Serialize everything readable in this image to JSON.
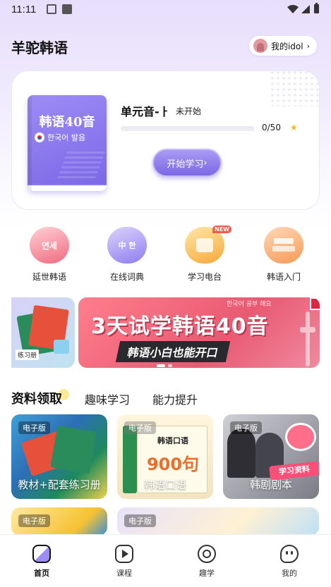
{
  "status": {
    "time": "11:11"
  },
  "header": {
    "title": "羊驼韩语",
    "idol_label": "我的idol"
  },
  "study_card": {
    "book_title": "韩语40音",
    "book_subtitle": "한국어 발음",
    "unit_title": "单元音-ㅏ",
    "unit_status": "未开始",
    "progress_text": "0/50",
    "progress_fraction": 0,
    "start_button": "开始学习"
  },
  "quick_links": [
    {
      "label": "延世韩语",
      "icon": "book-icon",
      "icon_text": "연세"
    },
    {
      "label": "在线词典",
      "icon": "dictionary-icon",
      "icon_text": "中 한"
    },
    {
      "label": "学习电台",
      "icon": "radio-icon",
      "badge": "NEW"
    },
    {
      "label": "韩语入门",
      "icon": "stack-books-icon"
    }
  ],
  "banner": {
    "side_tag": "练习册",
    "headline_num": "3",
    "headline": "天试学韩语40音",
    "subline": "韩语小白也能开口",
    "korean_text": "한국어 공부 해요"
  },
  "section_tabs": [
    "资料领取",
    "趣味学习",
    "能力提升"
  ],
  "resources": [
    {
      "badge": "电子版",
      "caption": "教材+配套练习册"
    },
    {
      "badge": "电子版",
      "caption": "韩语口语",
      "book_text": "韩语口语",
      "book_big": "900句"
    },
    {
      "badge": "电子版",
      "caption": "韩剧剧本",
      "sticker": "学习资料"
    },
    {
      "badge": "电子版"
    },
    {
      "badge": "电子版"
    }
  ],
  "nav": [
    {
      "label": "首页",
      "icon": "home-icon",
      "active": true
    },
    {
      "label": "课程",
      "icon": "play-icon"
    },
    {
      "label": "趣学",
      "icon": "fun-icon"
    },
    {
      "label": "我的",
      "icon": "profile-icon"
    }
  ]
}
